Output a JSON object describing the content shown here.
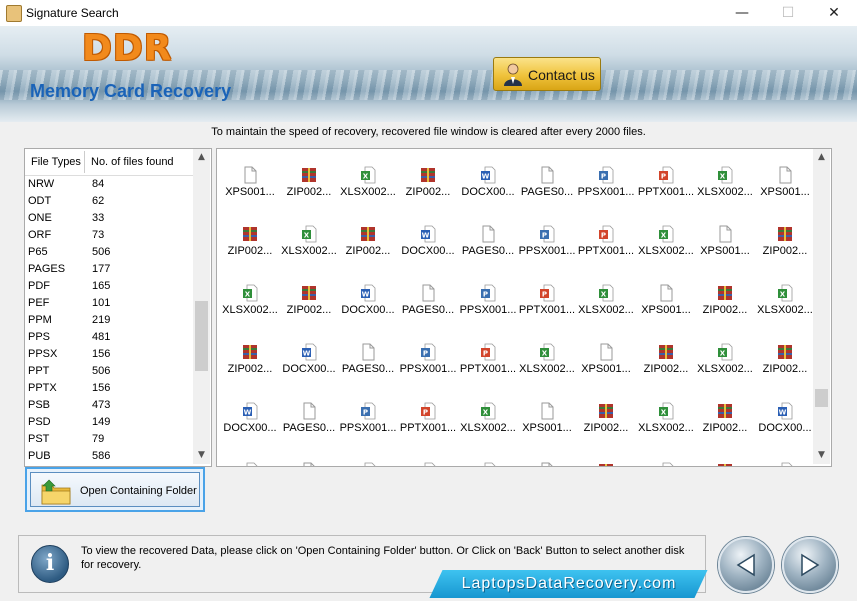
{
  "window": {
    "title": "Signature Search",
    "minimize": "—",
    "maximize": "☐",
    "close": "✕"
  },
  "banner": {
    "logo": "DDR",
    "product": "Memory Card Recovery",
    "contact_label": "Contact us"
  },
  "notice": "To maintain the speed of recovery, recovered file window is cleared after every 2000 files.",
  "file_table": {
    "headers": [
      "File Types",
      "No. of files found"
    ],
    "rows": [
      [
        "NRW",
        "84"
      ],
      [
        "ODT",
        "62"
      ],
      [
        "ONE",
        "33"
      ],
      [
        "ORF",
        "73"
      ],
      [
        "P65",
        "506"
      ],
      [
        "PAGES",
        "177"
      ],
      [
        "PDF",
        "165"
      ],
      [
        "PEF",
        "101"
      ],
      [
        "PPM",
        "219"
      ],
      [
        "PPS",
        "481"
      ],
      [
        "PPSX",
        "156"
      ],
      [
        "PPT",
        "506"
      ],
      [
        "PPTX",
        "156"
      ],
      [
        "PSB",
        "473"
      ],
      [
        "PSD",
        "149"
      ],
      [
        "PST",
        "79"
      ],
      [
        "PUB",
        "586"
      ]
    ]
  },
  "open_folder_label": "Open Containing Folder",
  "files": [
    [
      "XPS001...",
      "ZIP002...",
      "XLSX002...",
      "ZIP002...",
      "DOCX00...",
      "PAGES0...",
      "PPSX001...",
      "PPTX001...",
      "XLSX002...",
      "XPS001..."
    ],
    [
      "ZIP002...",
      "XLSX002...",
      "ZIP002...",
      "DOCX00...",
      "PAGES0...",
      "PPSX001...",
      "PPTX001...",
      "XLSX002...",
      "XPS001...",
      "ZIP002..."
    ],
    [
      "XLSX002...",
      "ZIP002...",
      "DOCX00...",
      "PAGES0...",
      "PPSX001...",
      "PPTX001...",
      "XLSX002...",
      "XPS001...",
      "ZIP002...",
      "XLSX002..."
    ],
    [
      "ZIP002...",
      "DOCX00...",
      "PAGES0...",
      "PPSX001...",
      "PPTX001...",
      "XLSX002...",
      "XPS001...",
      "ZIP002...",
      "XLSX002...",
      "ZIP002..."
    ],
    [
      "DOCX00...",
      "PAGES0...",
      "PPSX001...",
      "PPTX001...",
      "XLSX002...",
      "XPS001...",
      "ZIP002...",
      "XLSX002...",
      "ZIP002...",
      "DOCX00..."
    ]
  ],
  "info_text": "To view the recovered Data, please click on 'Open Containing Folder' button. Or Click on 'Back' Button to select another disk for recovery.",
  "website": "LaptopsDataRecovery.com",
  "icon_colors": {
    "zip": "#b0342c",
    "xlsx": "#2f8f3a",
    "docx": "#2b5fb4",
    "pptx": "#d2452b",
    "ppsx": "#3a6fb0",
    "blank": "#9a9a9a"
  }
}
